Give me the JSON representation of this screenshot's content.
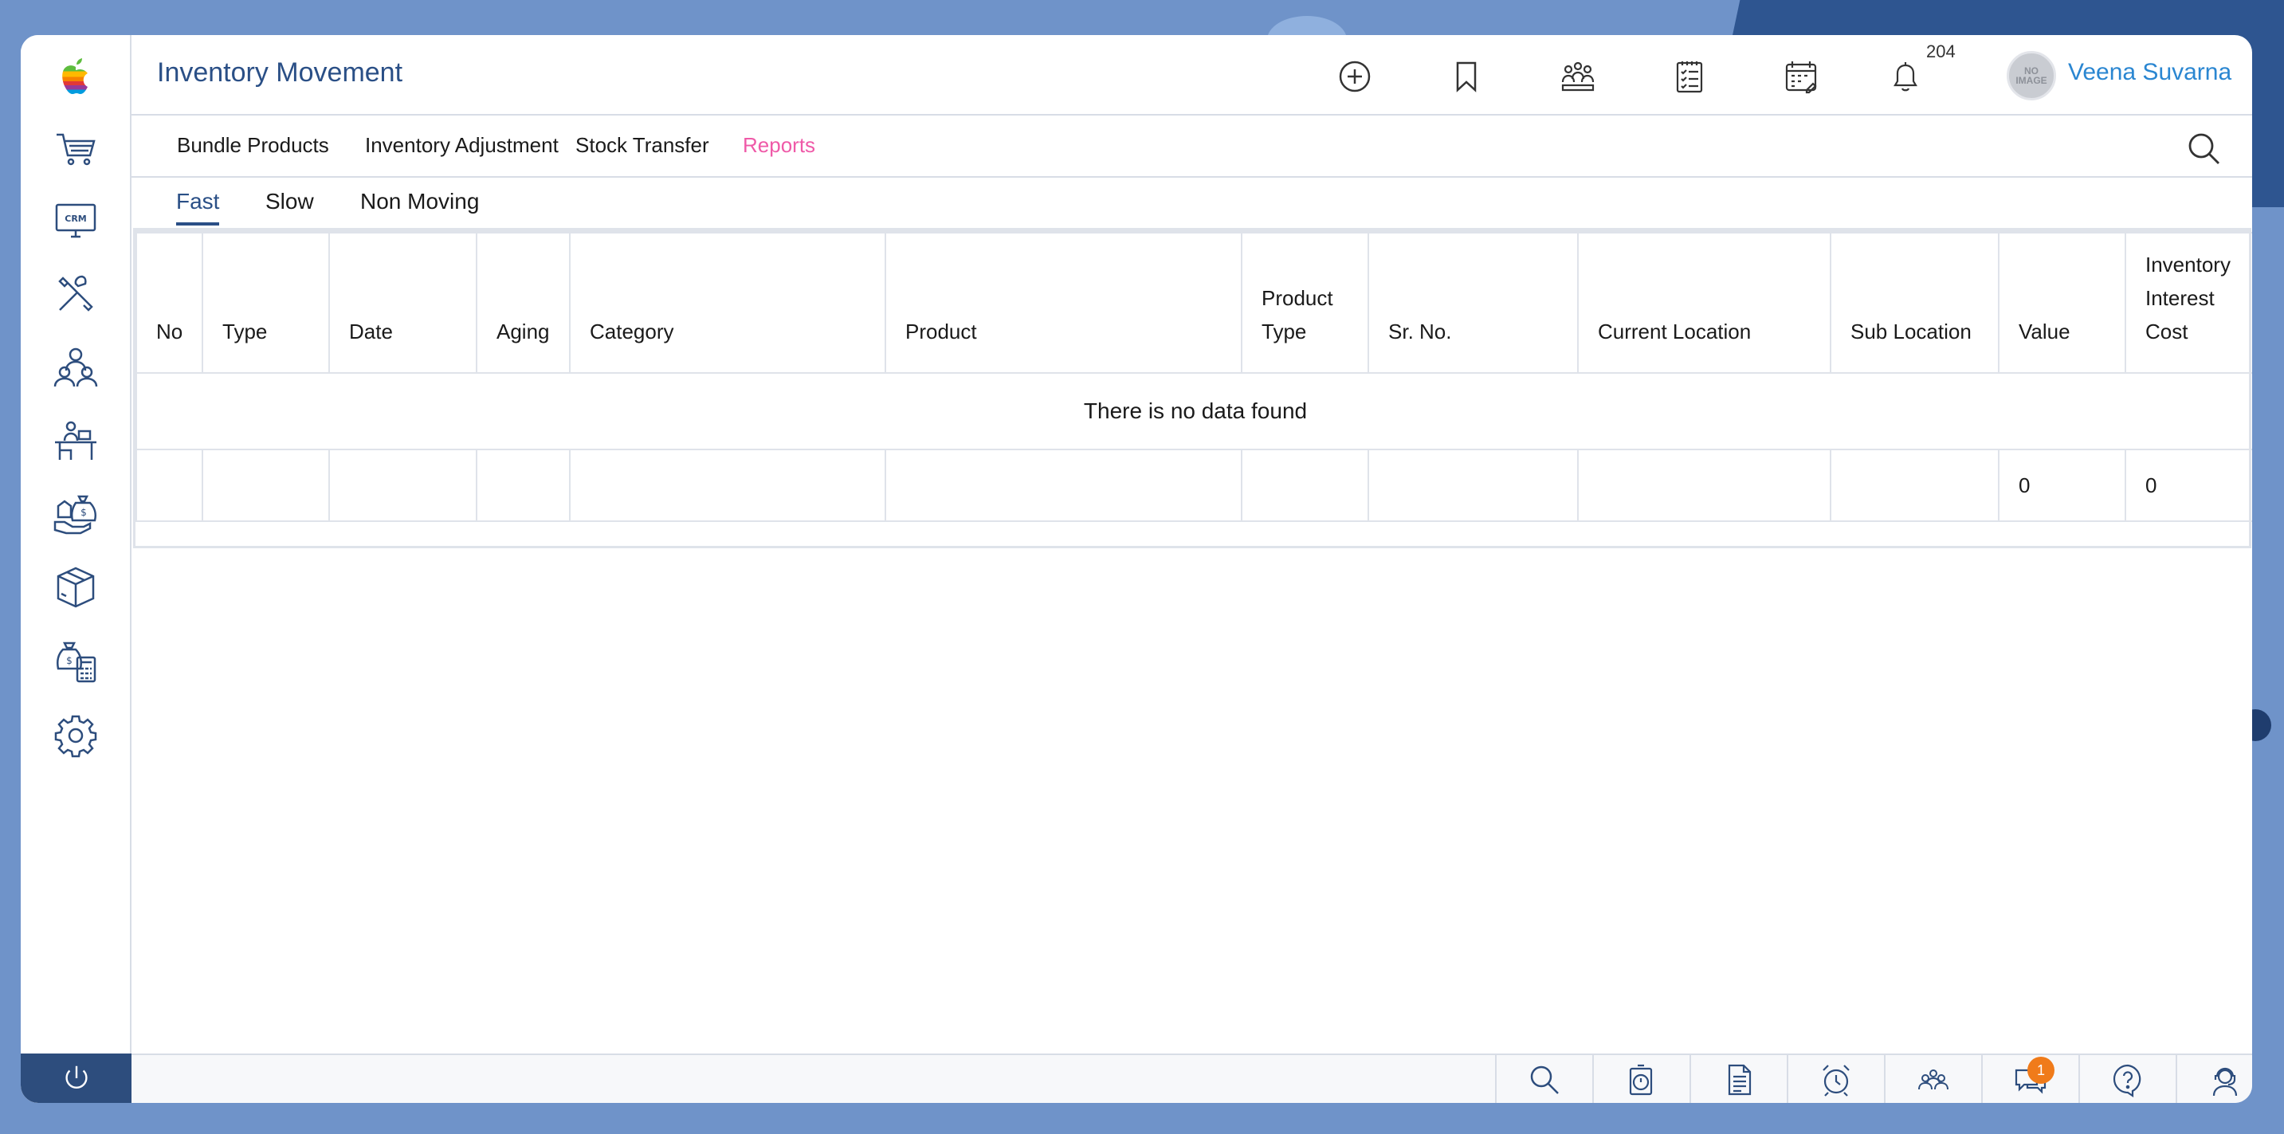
{
  "header": {
    "title": "Inventory Movement",
    "notification_count": "204",
    "avatar_text": "NO IMAGE",
    "user_name": "Veena Suvarna"
  },
  "subnav": {
    "items": [
      {
        "label": "Bundle Products"
      },
      {
        "label": "Inventory Adjustment"
      },
      {
        "label": "Stock Transfer"
      },
      {
        "label": "Reports",
        "active": true
      }
    ]
  },
  "tabs": [
    {
      "label": "Fast",
      "active": true
    },
    {
      "label": "Slow"
    },
    {
      "label": "Non Moving"
    }
  ],
  "table": {
    "columns": [
      "No",
      "Type",
      "Date",
      "Aging",
      "Category",
      "Product",
      "Product Type",
      "Sr. No.",
      "Current Location",
      "Sub Location",
      "Value",
      "Inventory Interest Cost"
    ],
    "empty_message": "There is no data found",
    "totals": {
      "value": "0",
      "inventory_interest_cost": "0"
    }
  },
  "footer": {
    "chat_badge": "1"
  },
  "colors": {
    "accent": "#2a4f86",
    "active_link": "#ef5aa8",
    "badge": "#f07b1a",
    "user_name": "#2a86d1"
  },
  "icons": {
    "sidebar": [
      "apple-logo-icon",
      "cart-icon",
      "crm-monitor-icon",
      "tools-icon",
      "team-icon",
      "desk-icon",
      "money-bag-icon",
      "box-icon",
      "calculator-money-icon",
      "gear-icon"
    ],
    "header": [
      "plus-circle-icon",
      "bookmark-icon",
      "meeting-icon",
      "checklist-icon",
      "calendar-icon",
      "bell-icon"
    ],
    "footer": [
      "search-icon",
      "stopwatch-icon",
      "document-icon",
      "alarm-icon",
      "people-icon",
      "chat-icon",
      "help-icon",
      "support-agent-icon"
    ]
  }
}
